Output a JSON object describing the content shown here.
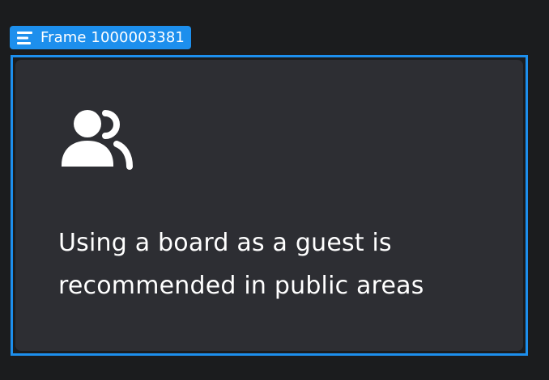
{
  "frame": {
    "label": "Frame 1000003381",
    "label_icon": "frame-layout-icon",
    "accent_color": "#1d8fed"
  },
  "card": {
    "icon": "users-icon",
    "message_line1": "Using a board as a guest is",
    "message_line2": "recommended in public areas",
    "background": "#2d2e33"
  }
}
